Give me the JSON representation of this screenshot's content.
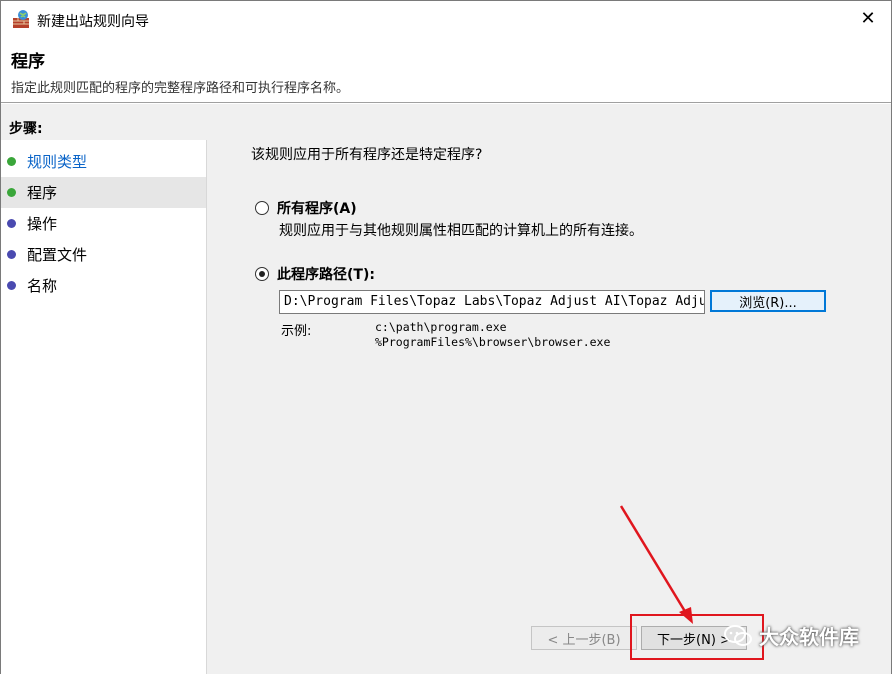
{
  "window": {
    "title": "新建出站规则向导",
    "close_glyph": "✕"
  },
  "header": {
    "title": "程序",
    "description": "指定此规则匹配的程序的完整程序路径和可执行程序名称。"
  },
  "sidebar": {
    "title": "步骤:",
    "steps": [
      {
        "label": "规则类型",
        "state": "done"
      },
      {
        "label": "程序",
        "state": "current"
      },
      {
        "label": "操作",
        "state": "pending"
      },
      {
        "label": "配置文件",
        "state": "pending"
      },
      {
        "label": "名称",
        "state": "pending"
      }
    ]
  },
  "content": {
    "question": "该规则应用于所有程序还是特定程序?",
    "options": [
      {
        "label": "所有程序(A)",
        "description": "规则应用于与其他规则属性相匹配的计算机上的所有连接。",
        "checked": false
      },
      {
        "label": "此程序路径(T):",
        "checked": true
      }
    ],
    "path_value": "D:\\Program Files\\Topaz Labs\\Topaz Adjust AI\\Topaz Adjust",
    "browse_label": "浏览(R)...",
    "example_label": "示例:",
    "example_lines": [
      "c:\\path\\program.exe",
      "%ProgramFiles%\\browser\\browser.exe"
    ]
  },
  "footer": {
    "back_label": "< 上一步(B)",
    "next_label": "下一步(N) >"
  },
  "watermark": {
    "text": "大众软件库"
  },
  "colors": {
    "step_done": "#3aa63a",
    "step_pending": "#4a4ab0",
    "link": "#0a64c8",
    "highlight": "#e0161e"
  }
}
